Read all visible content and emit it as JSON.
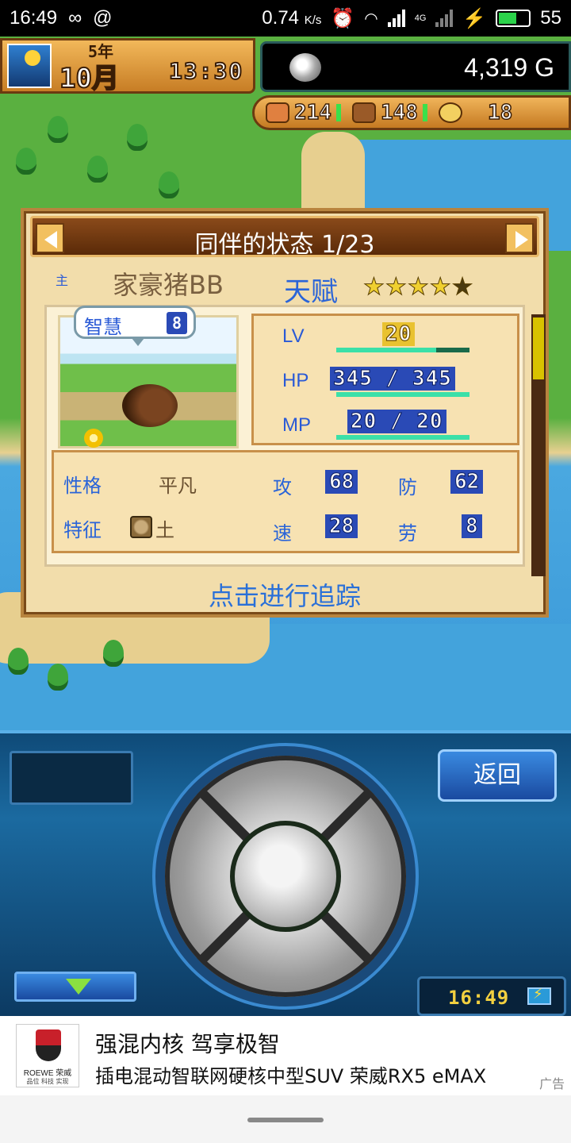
{
  "statusbar": {
    "time": "16:49",
    "speed": "0.74",
    "speed_unit": "K/s",
    "network": "4G",
    "battery": "55"
  },
  "hud": {
    "year": "5年",
    "month": "10月",
    "clock": "13:30",
    "gold": "4,319 G",
    "resources": [
      {
        "icon": "meat-icon",
        "value": "214"
      },
      {
        "icon": "wood-icon",
        "value": "148"
      },
      {
        "icon": "medal-icon",
        "value": "18"
      }
    ]
  },
  "panel": {
    "title": "同伴的状态 1/23",
    "name_tag": "主",
    "name": "家豪猪BB",
    "talent_label": "天赋",
    "stars": 4,
    "stars_max": 5,
    "bubble_label": "智慧",
    "bubble_value": "8",
    "stats": {
      "lv_label": "LV",
      "lv": "20",
      "lv_progress": 0.75,
      "hp_label": "HP",
      "hp": "345 / 345",
      "hp_progress": 1.0,
      "mp_label": "MP",
      "mp": "20 / 20",
      "mp_progress": 1.0
    },
    "attrs": {
      "personality_label": "性格",
      "personality": "平凡",
      "trait_label": "特征",
      "trait": "土",
      "atk_label": "攻",
      "atk": "68",
      "def_label": "防",
      "def": "62",
      "spd_label": "速",
      "spd": "28",
      "labor_label": "劳",
      "labor": "8"
    },
    "track_link": "点击进行追踪"
  },
  "controls": {
    "back": "返回",
    "clock": "16:49"
  },
  "ad": {
    "line1": "强混内核 驾享极智",
    "line2": "插电混动智联网硬核中型SUV 荣威RX5 eMAX",
    "tag": "广告",
    "brand": "ROEWE 荣威",
    "brand_sub": "品位 科技 实现"
  },
  "colors": {
    "panel_bg": "#f2ddab",
    "accent_blue": "#2a64d8",
    "value_box": "#2a4ab6",
    "control_bg": "#1b6aa0"
  }
}
